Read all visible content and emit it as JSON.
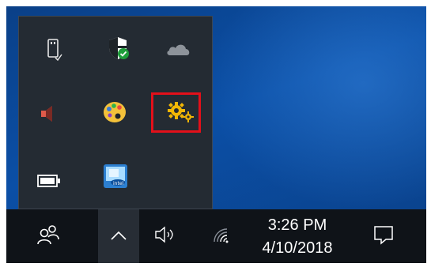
{
  "flyout": {
    "icons": [
      {
        "name": "usb-drive-icon"
      },
      {
        "name": "windows-defender-icon"
      },
      {
        "name": "onedrive-cloud-icon"
      },
      {
        "name": "speaker-muted-icon"
      },
      {
        "name": "paint-palette-icon"
      },
      {
        "name": "gear-settings-icon"
      },
      {
        "name": "battery-icon"
      },
      {
        "name": "intel-graphics-icon"
      }
    ],
    "highlighted_icon": "gear-settings-icon",
    "highlight_color": "#e3101a"
  },
  "taskbar": {
    "people_icon": "people-icon",
    "chevron_icon": "chevron-up-icon",
    "volume_icon": "volume-icon",
    "network_icon": "wifi-icon",
    "action_center_icon": "notification-icon",
    "clock": {
      "time": "3:26 PM",
      "date": "4/10/2018"
    }
  },
  "colors": {
    "taskbar": "#0f1318",
    "flyout": "#242b33",
    "desktop": "#0b4fa6"
  }
}
